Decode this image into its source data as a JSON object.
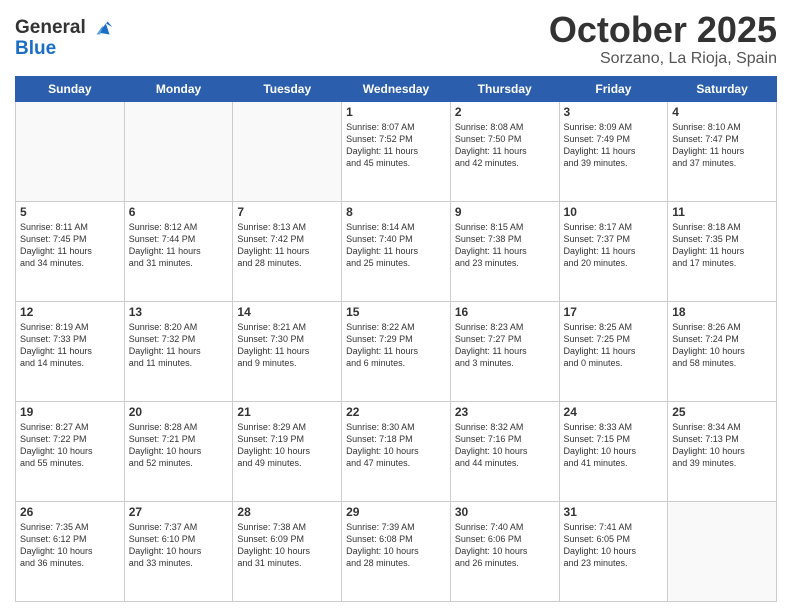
{
  "header": {
    "logo_line1": "General",
    "logo_line2": "Blue",
    "month": "October 2025",
    "location": "Sorzano, La Rioja, Spain"
  },
  "weekdays": [
    "Sunday",
    "Monday",
    "Tuesday",
    "Wednesday",
    "Thursday",
    "Friday",
    "Saturday"
  ],
  "weeks": [
    [
      {
        "day": "",
        "info": ""
      },
      {
        "day": "",
        "info": ""
      },
      {
        "day": "",
        "info": ""
      },
      {
        "day": "1",
        "info": "Sunrise: 8:07 AM\nSunset: 7:52 PM\nDaylight: 11 hours\nand 45 minutes."
      },
      {
        "day": "2",
        "info": "Sunrise: 8:08 AM\nSunset: 7:50 PM\nDaylight: 11 hours\nand 42 minutes."
      },
      {
        "day": "3",
        "info": "Sunrise: 8:09 AM\nSunset: 7:49 PM\nDaylight: 11 hours\nand 39 minutes."
      },
      {
        "day": "4",
        "info": "Sunrise: 8:10 AM\nSunset: 7:47 PM\nDaylight: 11 hours\nand 37 minutes."
      }
    ],
    [
      {
        "day": "5",
        "info": "Sunrise: 8:11 AM\nSunset: 7:45 PM\nDaylight: 11 hours\nand 34 minutes."
      },
      {
        "day": "6",
        "info": "Sunrise: 8:12 AM\nSunset: 7:44 PM\nDaylight: 11 hours\nand 31 minutes."
      },
      {
        "day": "7",
        "info": "Sunrise: 8:13 AM\nSunset: 7:42 PM\nDaylight: 11 hours\nand 28 minutes."
      },
      {
        "day": "8",
        "info": "Sunrise: 8:14 AM\nSunset: 7:40 PM\nDaylight: 11 hours\nand 25 minutes."
      },
      {
        "day": "9",
        "info": "Sunrise: 8:15 AM\nSunset: 7:38 PM\nDaylight: 11 hours\nand 23 minutes."
      },
      {
        "day": "10",
        "info": "Sunrise: 8:17 AM\nSunset: 7:37 PM\nDaylight: 11 hours\nand 20 minutes."
      },
      {
        "day": "11",
        "info": "Sunrise: 8:18 AM\nSunset: 7:35 PM\nDaylight: 11 hours\nand 17 minutes."
      }
    ],
    [
      {
        "day": "12",
        "info": "Sunrise: 8:19 AM\nSunset: 7:33 PM\nDaylight: 11 hours\nand 14 minutes."
      },
      {
        "day": "13",
        "info": "Sunrise: 8:20 AM\nSunset: 7:32 PM\nDaylight: 11 hours\nand 11 minutes."
      },
      {
        "day": "14",
        "info": "Sunrise: 8:21 AM\nSunset: 7:30 PM\nDaylight: 11 hours\nand 9 minutes."
      },
      {
        "day": "15",
        "info": "Sunrise: 8:22 AM\nSunset: 7:29 PM\nDaylight: 11 hours\nand 6 minutes."
      },
      {
        "day": "16",
        "info": "Sunrise: 8:23 AM\nSunset: 7:27 PM\nDaylight: 11 hours\nand 3 minutes."
      },
      {
        "day": "17",
        "info": "Sunrise: 8:25 AM\nSunset: 7:25 PM\nDaylight: 11 hours\nand 0 minutes."
      },
      {
        "day": "18",
        "info": "Sunrise: 8:26 AM\nSunset: 7:24 PM\nDaylight: 10 hours\nand 58 minutes."
      }
    ],
    [
      {
        "day": "19",
        "info": "Sunrise: 8:27 AM\nSunset: 7:22 PM\nDaylight: 10 hours\nand 55 minutes."
      },
      {
        "day": "20",
        "info": "Sunrise: 8:28 AM\nSunset: 7:21 PM\nDaylight: 10 hours\nand 52 minutes."
      },
      {
        "day": "21",
        "info": "Sunrise: 8:29 AM\nSunset: 7:19 PM\nDaylight: 10 hours\nand 49 minutes."
      },
      {
        "day": "22",
        "info": "Sunrise: 8:30 AM\nSunset: 7:18 PM\nDaylight: 10 hours\nand 47 minutes."
      },
      {
        "day": "23",
        "info": "Sunrise: 8:32 AM\nSunset: 7:16 PM\nDaylight: 10 hours\nand 44 minutes."
      },
      {
        "day": "24",
        "info": "Sunrise: 8:33 AM\nSunset: 7:15 PM\nDaylight: 10 hours\nand 41 minutes."
      },
      {
        "day": "25",
        "info": "Sunrise: 8:34 AM\nSunset: 7:13 PM\nDaylight: 10 hours\nand 39 minutes."
      }
    ],
    [
      {
        "day": "26",
        "info": "Sunrise: 7:35 AM\nSunset: 6:12 PM\nDaylight: 10 hours\nand 36 minutes."
      },
      {
        "day": "27",
        "info": "Sunrise: 7:37 AM\nSunset: 6:10 PM\nDaylight: 10 hours\nand 33 minutes."
      },
      {
        "day": "28",
        "info": "Sunrise: 7:38 AM\nSunset: 6:09 PM\nDaylight: 10 hours\nand 31 minutes."
      },
      {
        "day": "29",
        "info": "Sunrise: 7:39 AM\nSunset: 6:08 PM\nDaylight: 10 hours\nand 28 minutes."
      },
      {
        "day": "30",
        "info": "Sunrise: 7:40 AM\nSunset: 6:06 PM\nDaylight: 10 hours\nand 26 minutes."
      },
      {
        "day": "31",
        "info": "Sunrise: 7:41 AM\nSunset: 6:05 PM\nDaylight: 10 hours\nand 23 minutes."
      },
      {
        "day": "",
        "info": ""
      }
    ]
  ]
}
